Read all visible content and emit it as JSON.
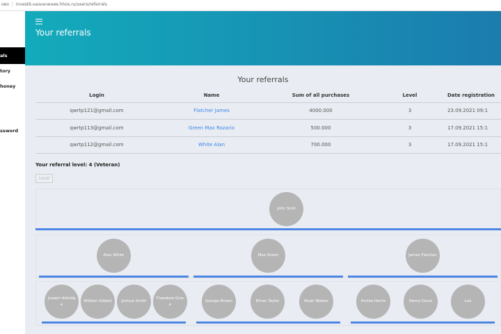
{
  "browser": {
    "prefix": "ово",
    "url": "invest6.назначение.hhos.ru/users/referrals"
  },
  "sidebar": {
    "items": [
      {
        "label": "als",
        "active": true
      },
      {
        "label": "tory"
      },
      {
        "label": "honey"
      },
      {
        "label": "ssword"
      }
    ]
  },
  "header": {
    "title": "Your referrals"
  },
  "content": {
    "title": "Your referrals",
    "columns": [
      "Login",
      "Name",
      "Sum of all purchases",
      "Level",
      "Date registration"
    ],
    "rows": [
      [
        "qwrtp121@gmail.com",
        "Flatcher James",
        "4000.000",
        "3",
        "23.09.2021 09:1"
      ],
      [
        "qwrtp113@gmail.com",
        "Green Max Rozario",
        "500.000",
        "3",
        "17.09.2021 15:1"
      ],
      [
        "qwrtp112@gmail.com",
        "White Alan",
        "700.000",
        "3",
        "17.09.2021 15:1"
      ]
    ],
    "referral_level": "Your referral level: 4 (Veteran)",
    "level_button": "Level"
  },
  "tree": {
    "root": "John Smit",
    "level2": [
      "Alan White",
      "Max Green",
      "James Flatcher"
    ],
    "level3": [
      [
        "Joseph Aldridge",
        "William Gilbert",
        "Joshua Smith",
        "Theodore Grace"
      ],
      [
        "George Brown",
        "Ethan Taylor",
        "Noah Walker"
      ],
      [
        "Archie Harris",
        "Henry Davis",
        "Leo"
      ]
    ]
  },
  "colors": {
    "accent": "#4b86e3",
    "link": "#3a86e8",
    "header_start": "#13abbb",
    "header_end": "#1b7cae"
  }
}
